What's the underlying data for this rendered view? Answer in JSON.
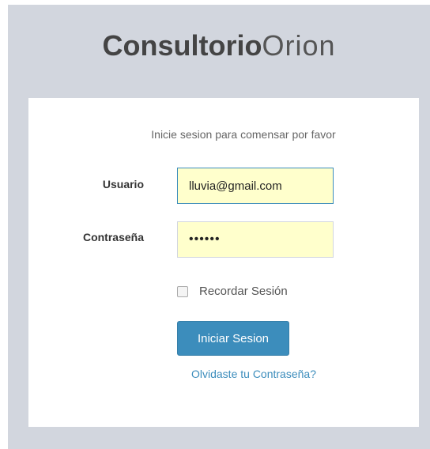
{
  "logo": {
    "bold": "Consultorio",
    "light": "Orion"
  },
  "login": {
    "message": "Inicie sesion para comensar por favor",
    "username_label": "Usuario",
    "username_value": "lluvia@gmail.com",
    "password_label": "Contraseña",
    "password_value": "••••••",
    "remember_label": "Recordar Sesión",
    "remember_checked": false,
    "submit_label": "Iniciar Sesion",
    "forgot_label": "Olvidaste tu Contraseña?"
  },
  "colors": {
    "background": "#d2d6de",
    "primary": "#3c8dbc",
    "input_fill": "#ffffcc"
  }
}
